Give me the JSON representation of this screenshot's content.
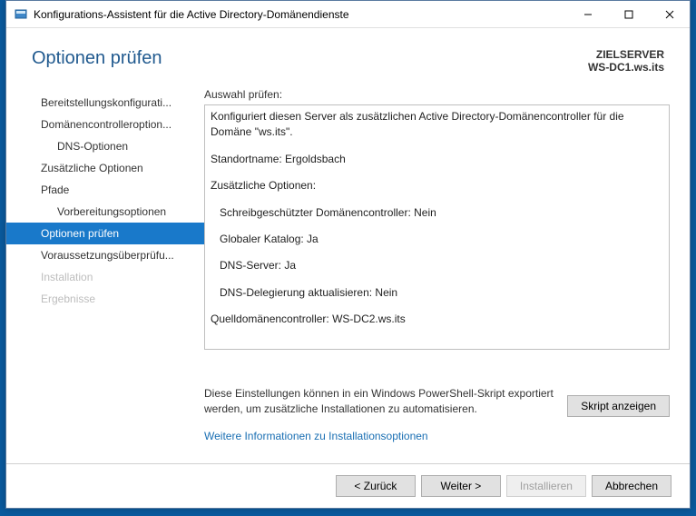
{
  "window": {
    "title": "Konfigurations-Assistent für die Active Directory-Domänendienste"
  },
  "header": {
    "page_title": "Optionen prüfen",
    "target_label": "ZIELSERVER",
    "target_value": "WS-DC1.ws.its"
  },
  "sidebar": {
    "steps": [
      {
        "label": "Bereitstellungskonfigurati...",
        "sub": false,
        "state": "normal"
      },
      {
        "label": "Domänencontrolleroption...",
        "sub": false,
        "state": "normal"
      },
      {
        "label": "DNS-Optionen",
        "sub": true,
        "state": "normal"
      },
      {
        "label": "Zusätzliche Optionen",
        "sub": false,
        "state": "normal"
      },
      {
        "label": "Pfade",
        "sub": false,
        "state": "normal"
      },
      {
        "label": "Vorbereitungsoptionen",
        "sub": true,
        "state": "normal"
      },
      {
        "label": "Optionen prüfen",
        "sub": false,
        "state": "selected"
      },
      {
        "label": "Voraussetzungsüberprüfu...",
        "sub": false,
        "state": "normal"
      },
      {
        "label": "Installation",
        "sub": false,
        "state": "disabled"
      },
      {
        "label": "Ergebnisse",
        "sub": false,
        "state": "disabled"
      }
    ]
  },
  "main": {
    "section_label": "Auswahl prüfen:",
    "review_lines": [
      "Konfiguriert diesen Server als zusätzlichen Active Directory-Domänencontroller für die Domäne \"ws.its\".",
      "Standortname: Ergoldsbach",
      "Zusätzliche Optionen:",
      "  Schreibgeschützter Domänencontroller: Nein",
      "  Globaler Katalog: Ja",
      "  DNS-Server: Ja",
      "  DNS-Delegierung aktualisieren: Nein",
      "Quelldomänencontroller: WS-DC2.ws.its"
    ],
    "hint": "Diese Einstellungen können in ein Windows PowerShell-Skript exportiert werden, um zusätzliche Installationen zu automatisieren.",
    "script_button": "Skript anzeigen",
    "more_link": "Weitere Informationen zu Installationsoptionen"
  },
  "footer": {
    "back": "< Zurück",
    "next": "Weiter >",
    "install": "Installieren",
    "cancel": "Abbrechen"
  }
}
